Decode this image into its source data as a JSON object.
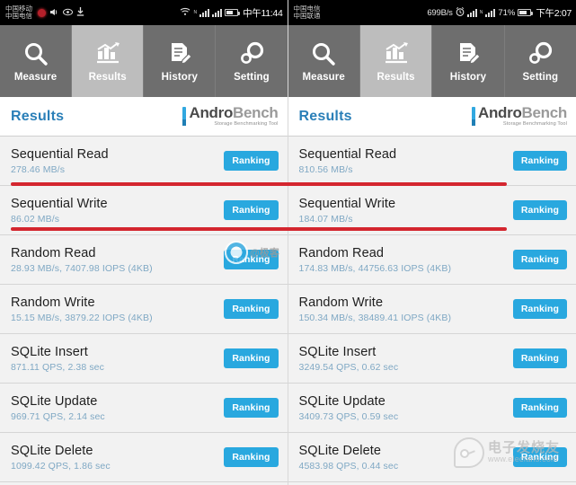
{
  "app": {
    "name": "AndroBench",
    "logo_word_part1": "Andro",
    "logo_word_part2": "Bench",
    "logo_subtitle": "Storage Benchmarking Tool",
    "page_title": "Results",
    "accent_color": "#29a8df",
    "tab_active_bg": "#bdbdbd",
    "tabbar_bg": "#6e6e6e",
    "annotation_color": "#d4262f",
    "value_text_color": "#7fa8c4"
  },
  "tabs": [
    {
      "label": "Measure",
      "icon": "search-icon",
      "active": false
    },
    {
      "label": "Results",
      "icon": "chart-icon",
      "active": true
    },
    {
      "label": "History",
      "icon": "document-edit-icon",
      "active": false
    },
    {
      "label": "Setting",
      "icon": "gears-icon",
      "active": false
    }
  ],
  "ranking_button_label": "Ranking",
  "left_phone": {
    "statusbar": {
      "carrier_line1": "中国移动",
      "carrier_line2": "中国电信",
      "network_speed": "",
      "battery_percent": "",
      "time": "中午11:44",
      "icons": [
        "record-dot-icon",
        "mute-icon",
        "eye-icon",
        "download-icon",
        "wifi-icon",
        "signal-bars-icon",
        "signal-bars-2-icon",
        "battery-icon"
      ]
    },
    "results": [
      {
        "name": "Sequential Read",
        "value": "278.46 MB/s",
        "highlighted": true
      },
      {
        "name": "Sequential Write",
        "value": "86.02 MB/s",
        "highlighted": true
      },
      {
        "name": "Random Read",
        "value": "28.93 MB/s, 7407.98 IOPS (4KB)",
        "highlighted": false
      },
      {
        "name": "Random Write",
        "value": "15.15 MB/s, 3879.22 IOPS (4KB)",
        "highlighted": false
      },
      {
        "name": "SQLite Insert",
        "value": "871.11 QPS, 2.38 sec",
        "highlighted": false
      },
      {
        "name": "SQLite Update",
        "value": "969.71 QPS, 2.14 sec",
        "highlighted": false
      },
      {
        "name": "SQLite Delete",
        "value": "1099.42 QPS, 1.86 sec",
        "highlighted": false
      }
    ]
  },
  "right_phone": {
    "statusbar": {
      "carrier_line1": "中国电信",
      "carrier_line2": "中国联通",
      "network_speed": "699B/s",
      "battery_percent": "71%",
      "time": "下午2:07",
      "icons": [
        "alarm-icon",
        "signal-bars-icon",
        "signal-bars-2-icon",
        "battery-icon"
      ]
    },
    "results": [
      {
        "name": "Sequential Read",
        "value": "810.56 MB/s",
        "highlighted": true
      },
      {
        "name": "Sequential Write",
        "value": "184.07 MB/s",
        "highlighted": true
      },
      {
        "name": "Random Read",
        "value": "174.83 MB/s, 44756.63 IOPS (4KB)",
        "highlighted": false
      },
      {
        "name": "Random Write",
        "value": "150.34 MB/s, 38489.41 IOPS (4KB)",
        "highlighted": false
      },
      {
        "name": "SQLite Insert",
        "value": "3249.54 QPS, 0.62 sec",
        "highlighted": false
      },
      {
        "name": "SQLite Update",
        "value": "3409.73 QPS, 0.59 sec",
        "highlighted": false
      },
      {
        "name": "SQLite Delete",
        "value": "4583.98 QPS, 0.44 sec",
        "highlighted": false
      }
    ]
  },
  "watermarks": {
    "weibo_text": "@极客",
    "elecfans_cn": "电子发烧友",
    "elecfans_url": "www.elecfans.com"
  }
}
